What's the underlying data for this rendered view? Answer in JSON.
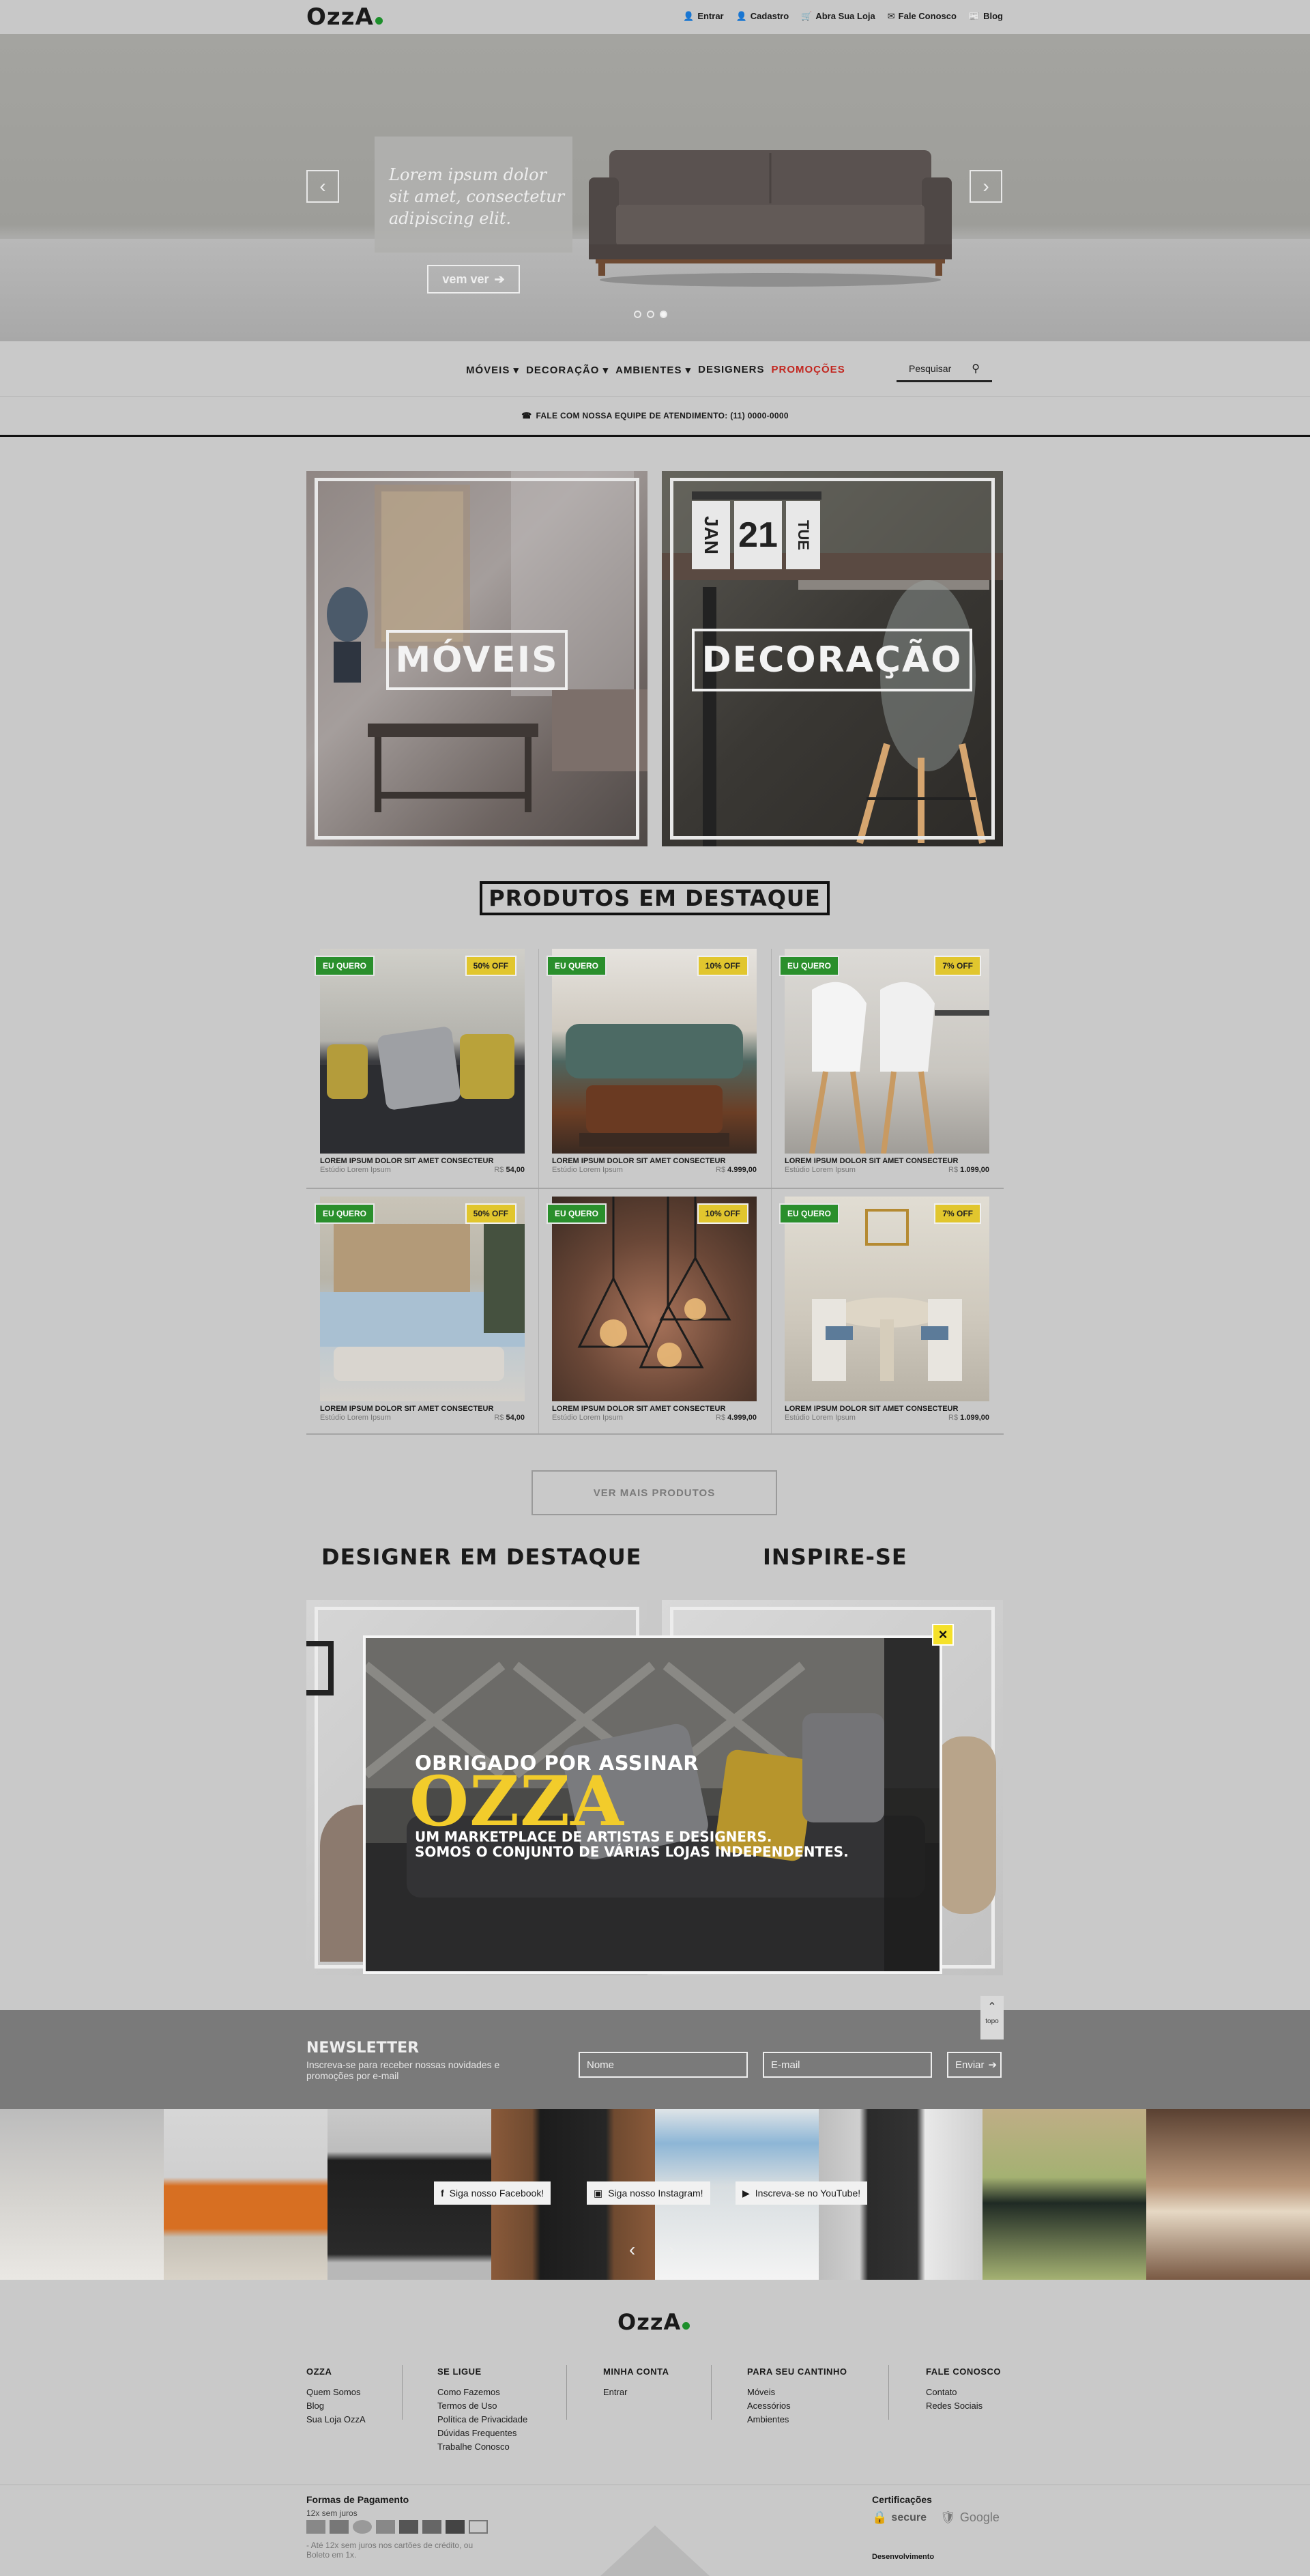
{
  "header": {
    "logo": "OzzA",
    "links": [
      {
        "icon": "user-icon",
        "label": "Entrar"
      },
      {
        "icon": "user-icon",
        "label": "Cadastro"
      },
      {
        "icon": "cart-icon",
        "label": "Abra Sua Loja"
      },
      {
        "icon": "envelope-icon",
        "label": "Fale Conosco"
      },
      {
        "icon": "newspaper-icon",
        "label": "Blog"
      }
    ]
  },
  "hero": {
    "text": "Lorem ipsum dolor sit amet, consectetur adipiscing elit.",
    "button": "vem ver",
    "slides": 3,
    "active_slide": 3
  },
  "nav": {
    "items": [
      "MÓVEIS",
      "DECORAÇÃO",
      "AMBIENTES",
      "DESIGNERS",
      "PROMOÇÕES"
    ],
    "search_placeholder": "Pesquisar",
    "call": "FALE COM NOSSA EQUIPE DE ATENDIMENTO: (11) 0000-0000"
  },
  "categories": [
    "MÓVEIS",
    "DECORAÇÃO"
  ],
  "calendar": {
    "month": "JAN",
    "day": "21",
    "weekday": "TUE"
  },
  "products": {
    "title": "PRODUTOS EM DESTAQUE",
    "items": [
      {
        "tag": "EU QUERO",
        "discount": "50% OFF",
        "name": "LOREM IPSUM DOLOR SIT AMET CONSECTEUR",
        "studio": "Estúdio Lorem Ipsum",
        "currency": "R$",
        "price": "54,00"
      },
      {
        "tag": "EU QUERO",
        "discount": "10% OFF",
        "name": "LOREM IPSUM DOLOR SIT AMET CONSECTEUR",
        "studio": "Estúdio Lorem Ipsum",
        "currency": "R$",
        "price": "4.999,00"
      },
      {
        "tag": "EU QUERO",
        "discount": "7% OFF",
        "name": "LOREM IPSUM DOLOR SIT AMET CONSECTEUR",
        "studio": "Estúdio Lorem Ipsum",
        "currency": "R$",
        "price": "1.099,00"
      },
      {
        "tag": "EU QUERO",
        "discount": "50% OFF",
        "name": "LOREM IPSUM DOLOR SIT AMET CONSECTEUR",
        "studio": "Estúdio Lorem Ipsum",
        "currency": "R$",
        "price": "54,00"
      },
      {
        "tag": "EU QUERO",
        "discount": "10% OFF",
        "name": "LOREM IPSUM DOLOR SIT AMET CONSECTEUR",
        "studio": "Estúdio Lorem Ipsum",
        "currency": "R$",
        "price": "4.999,00"
      },
      {
        "tag": "EU QUERO",
        "discount": "7% OFF",
        "name": "LOREM IPSUM DOLOR SIT AMET CONSECTEUR",
        "studio": "Estúdio Lorem Ipsum",
        "currency": "R$",
        "price": "1.099,00"
      }
    ],
    "more": "VER MAIS PRODUTOS"
  },
  "sections": {
    "designer": "DESIGNER EM DESTAQUE",
    "inspire": "INSPIRE-SE"
  },
  "modal": {
    "line1": "OBRIGADO POR ASSINAR",
    "brand": "OZZA",
    "line2": "UM MARKETPLACE DE ARTISTAS E DESIGNERS.",
    "line3": "SOMOS O CONJUNTO DE VÁRIAS LOJAS INDEPENDENTES.",
    "close": "×"
  },
  "top_button": "topo",
  "newsletter": {
    "title": "NEWSLETTER",
    "subtitle": "Inscreva-se para receber nossas novidades e promoções por e-mail",
    "name_placeholder": "Nome",
    "email_placeholder": "E-mail",
    "submit": "Enviar"
  },
  "social": {
    "facebook": "Siga nosso Facebook!",
    "instagram": "Siga nosso Instagram!",
    "youtube": "Inscreva-se no YouTube!"
  },
  "footer": {
    "logo": "OzzA",
    "columns": [
      {
        "title": "OZZA",
        "links": [
          "Quem Somos",
          "Blog",
          "Sua Loja OzzA"
        ]
      },
      {
        "title": "SE LIGUE",
        "links": [
          "Como Fazemos",
          "Termos de Uso",
          "Política de Privacidade",
          "Dúvidas Frequentes",
          "Trabalhe Conosco"
        ]
      },
      {
        "title": "MINHA CONTA",
        "links": [
          "Entrar"
        ]
      },
      {
        "title": "PARA SEU CANTINHO",
        "links": [
          "Móveis",
          "Acessórios",
          "Ambientes"
        ]
      },
      {
        "title": "FALE CONOSCO",
        "links": [
          "Contato",
          "Redes Sociais"
        ]
      }
    ],
    "payment_title": "Formas de Pagamento",
    "installments": "12x sem juros",
    "payment_note": "- Até 12x sem juros nos cartões de crédito, ou Boleto em 1x.",
    "cert_title": "Certificações",
    "secure": "secure",
    "google": "Google",
    "developed": "Desenvolvimento"
  },
  "colors": {
    "green": "#2a8f2c",
    "yellow": "#e1c62e",
    "promo": "#c2261f",
    "brand_dot": "#1d8f2b"
  }
}
